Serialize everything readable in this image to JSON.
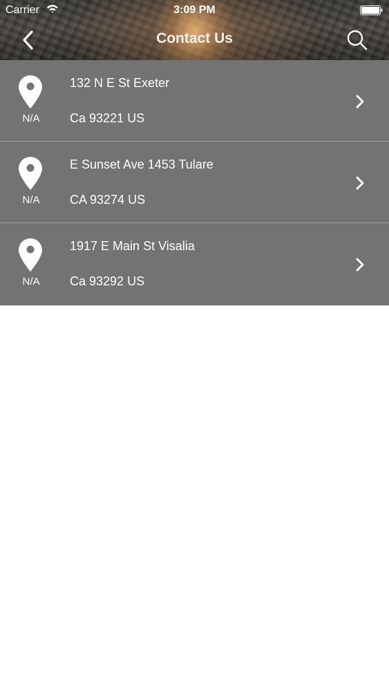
{
  "status_bar": {
    "carrier": "Carrier",
    "time": "3:09 PM"
  },
  "nav": {
    "title": "Contact Us",
    "back_icon": "chevron-left-icon",
    "search_icon": "search-icon"
  },
  "locations": [
    {
      "pin_label": "N/A",
      "line1": "132 N E St Exeter",
      "line2": "Ca 93221 US"
    },
    {
      "pin_label": "N/A",
      "line1": "E Sunset Ave 1453 Tulare",
      "line2": "CA 93274 US"
    },
    {
      "pin_label": "N/A",
      "line1": "1917 E Main St Visalia",
      "line2": "Ca 93292 US"
    }
  ],
  "colors": {
    "row_background": "#737373",
    "row_divider": "#9a9a9a",
    "text": "#ffffff"
  }
}
